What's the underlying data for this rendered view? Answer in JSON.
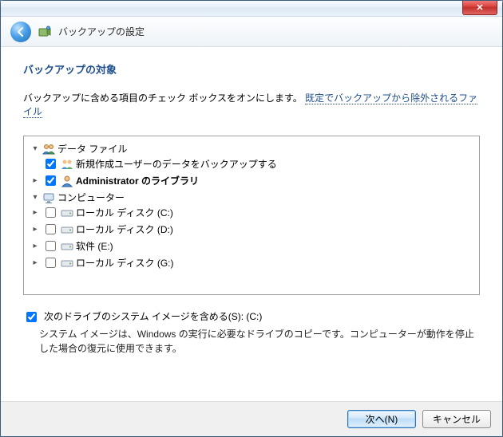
{
  "window": {
    "title": "バックアップの設定"
  },
  "page": {
    "heading": "バックアップの対象",
    "instruction": "バックアップに含める項目のチェック ボックスをオンにします。",
    "link": "既定でバックアップから除外されるファイル"
  },
  "tree": {
    "data_files": {
      "label": "データ ファイル",
      "new_user": "新規作成ユーザーのデータをバックアップする",
      "admin": "Administrator のライブラリ"
    },
    "computer": {
      "label": "コンピューター",
      "disks": [
        "ローカル ディスク (C:)",
        "ローカル ディスク (D:)",
        "软件 (E:)",
        "ローカル ディスク (G:)"
      ]
    }
  },
  "system_image": {
    "label": "次のドライブのシステム イメージを含める(S): (C:)",
    "desc": "システム イメージは、Windows の実行に必要なドライブのコピーです。コンピューターが動作を停止した場合の復元に使用できます。"
  },
  "footer": {
    "next": "次へ(N)",
    "cancel": "キャンセル"
  }
}
